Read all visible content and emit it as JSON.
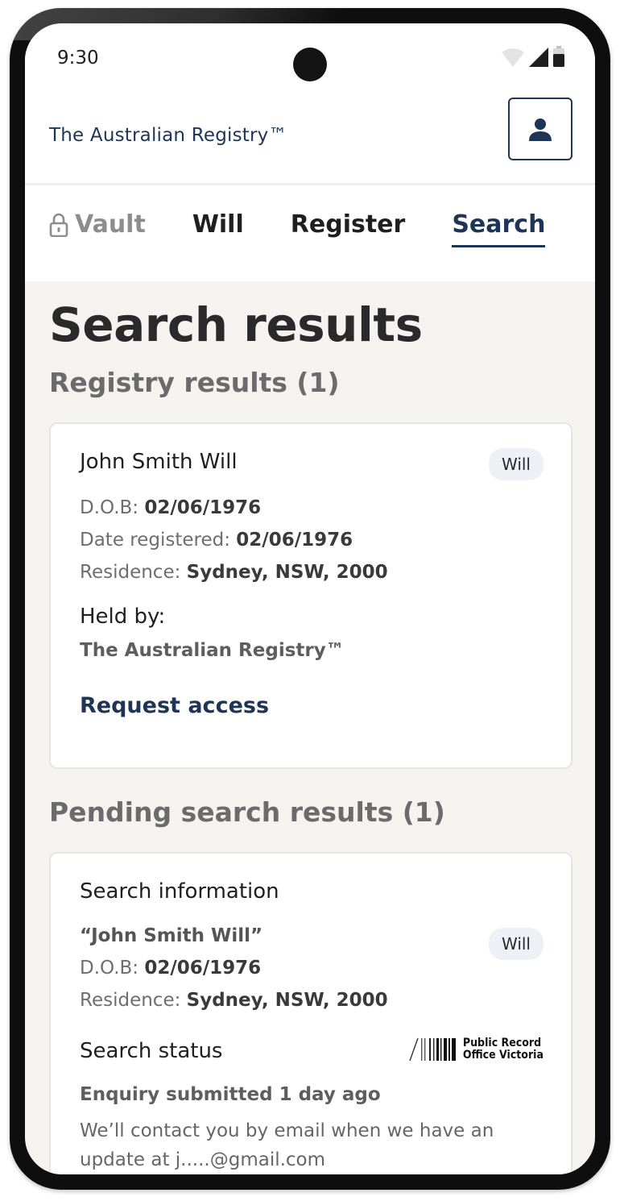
{
  "status_bar": {
    "time": "9:30"
  },
  "header": {
    "brand": "The Australian Registry™"
  },
  "nav": {
    "items": [
      {
        "label": "Vault"
      },
      {
        "label": "Will"
      },
      {
        "label": "Register"
      },
      {
        "label": "Search"
      }
    ]
  },
  "page": {
    "title": "Search results",
    "registry_section": "Registry results (1)",
    "pending_section": "Pending search results (1)"
  },
  "registry_result": {
    "title": "John Smith Will",
    "badge": "Will",
    "dob_label": "D.O.B:",
    "dob": "02/06/1976",
    "registered_label": "Date registered:",
    "registered": "02/06/1976",
    "residence_label": "Residence:",
    "residence": "Sydney, NSW, 2000",
    "held_by_label": "Held by:",
    "held_by": "The Australian Registry™",
    "request_access": "Request access"
  },
  "pending_result": {
    "title": "Search information",
    "query": "“John Smith Will”",
    "badge": "Will",
    "dob_label": "D.O.B:",
    "dob": "02/06/1976",
    "residence_label": "Residence:",
    "residence": "Sydney, NSW, 2000",
    "status_label": "Search status",
    "logo_line1": "Public Record",
    "logo_line2": "Office Victoria",
    "enquiry": "Enquiry submitted 1 day ago",
    "contact": "We’ll contact you by email when we have an update at j.....@gmail.com"
  },
  "colors": {
    "accent": "#1f3556",
    "background": "#f4f3f0",
    "badge_bg": "#edf1f5"
  }
}
